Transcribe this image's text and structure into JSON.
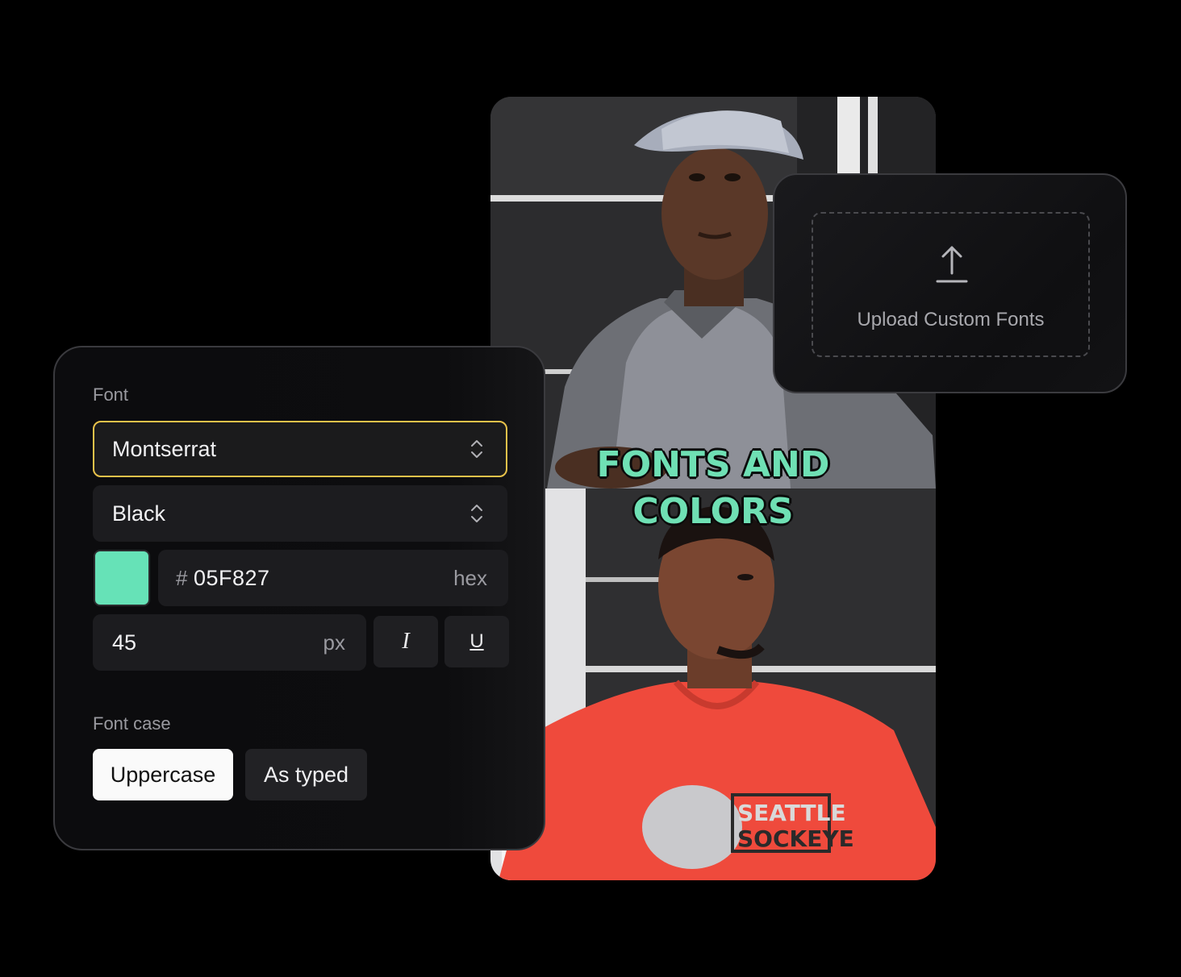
{
  "video": {
    "caption_line1": "FONTS AND",
    "caption_line2": "COLORS",
    "caption_color": "#6FE0B4"
  },
  "upload": {
    "icon": "upload-arrow-icon",
    "label": "Upload Custom Fonts"
  },
  "font_panel": {
    "font_label": "Font",
    "font_family": "Montserrat",
    "font_weight": "Black",
    "color_swatch": "#66E2B7",
    "hex_prefix": "#",
    "hex_value": "05F827",
    "hex_unit": "hex",
    "size_value": "45",
    "size_unit": "px",
    "italic_label": "I",
    "underline_label": "U",
    "case_label": "Font case",
    "case_uppercase": "Uppercase",
    "case_as_typed": "As typed",
    "active_border": "#E8C24A"
  }
}
